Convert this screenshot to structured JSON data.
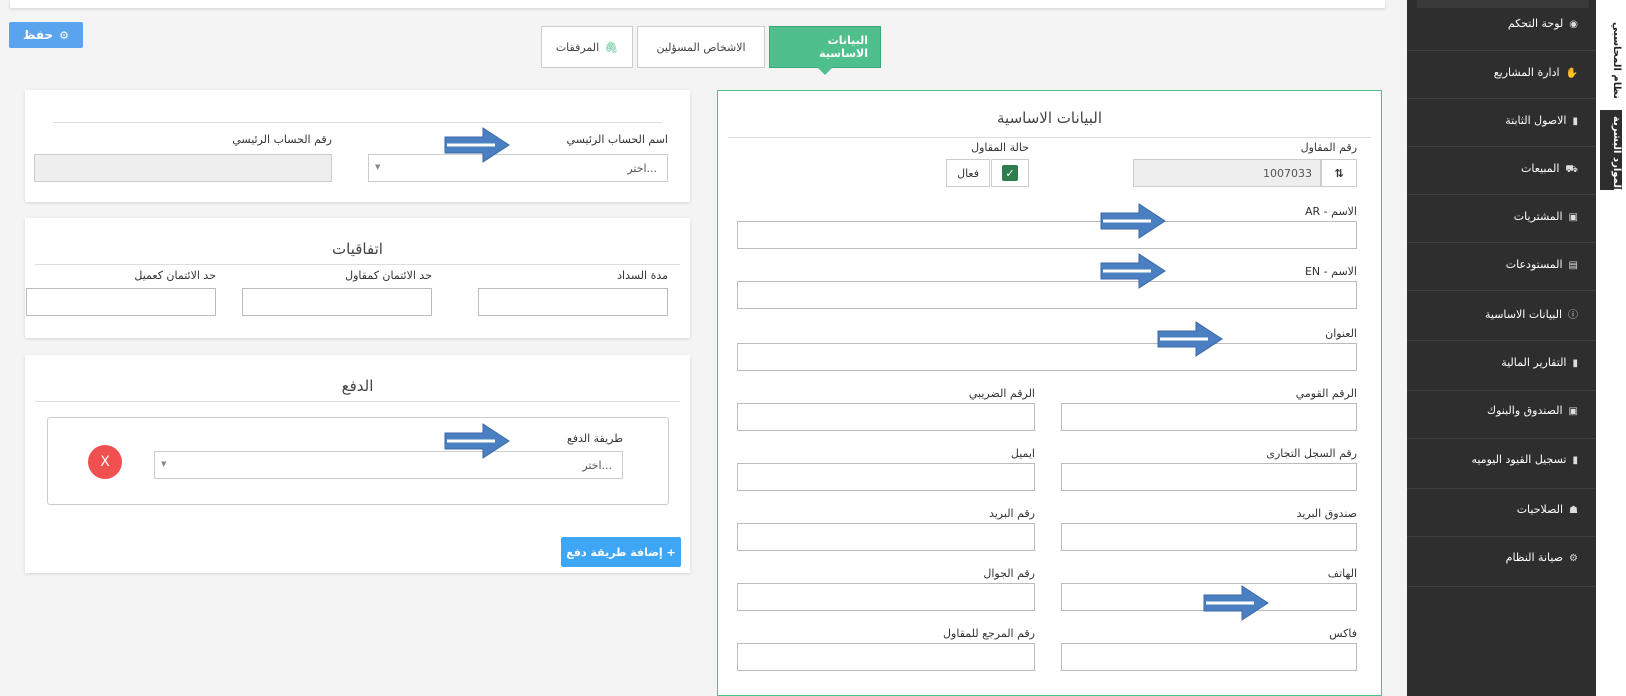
{
  "header": {
    "save_label": "حفظ"
  },
  "tabs": [
    {
      "label": "البيانات الاساسية",
      "active": true
    },
    {
      "label": "الاشخاص المسؤلين",
      "active": false
    },
    {
      "label": "المرفقات",
      "active": false
    }
  ],
  "basic": {
    "title": "البيانات الاساسية",
    "contractor_no_label": "رقم المقاول",
    "contractor_no_value": "1007033",
    "status_label": "حالة المقاول",
    "status_value": "فعال",
    "name_ar_label": "الاسم - AR",
    "name_en_label": "الاسم - EN",
    "address_label": "العنوان",
    "national_id_label": "الرقم القومي",
    "tax_no_label": "الرقم الضريبي",
    "commercial_reg_label": "رقم السجل التجارى",
    "email_label": "ايميل",
    "po_box_label": "صندوق البريد",
    "postal_code_label": "رقم البريد",
    "phone_label": "الهاتف",
    "mobile_label": "رقم الجوال",
    "fax_label": "فاكس",
    "reference_label": "رقم المرجع للمقاول"
  },
  "account": {
    "main_account_name_label": "اسم الحساب الرئيسي",
    "main_account_placeholder": "اختر...",
    "main_account_no_label": "رقم الحساب الرئيسي"
  },
  "agreements": {
    "title": "اتفاقيات",
    "payment_period_label": "مدة السداد",
    "credit_limit_contractor_label": "حد الائتمان كمقاول",
    "credit_limit_client_label": "حد الائتمان كعميل"
  },
  "payment": {
    "title": "الدفع",
    "method_label": "طريقة الدفع",
    "method_placeholder": "اختر...",
    "remove_label": "X",
    "add_label": "+ إضافة طريقة دفع"
  },
  "sidebar": {
    "items": [
      {
        "label": "لوحة التحكم",
        "icon": "dashboard-icon",
        "glyph": "◉"
      },
      {
        "label": "ادارة المشاريع",
        "icon": "handshake-icon",
        "glyph": "✋"
      },
      {
        "label": "الاصول الثابتة",
        "icon": "file-icon",
        "glyph": "▮"
      },
      {
        "label": "المبيعات",
        "icon": "truck-icon",
        "glyph": "⛟"
      },
      {
        "label": "المشتريات",
        "icon": "money-icon",
        "glyph": "▣"
      },
      {
        "label": "المستودعات",
        "icon": "archive-icon",
        "glyph": "▤"
      },
      {
        "label": "البيانات الاساسية",
        "icon": "info-icon",
        "glyph": "ⓘ"
      },
      {
        "label": "التقارير المالية",
        "icon": "file-icon",
        "glyph": "▮"
      },
      {
        "label": "الصندوق والبنوك",
        "icon": "money-icon",
        "glyph": "▣"
      },
      {
        "label": "تسجيل القيود اليوميه",
        "icon": "file-icon",
        "glyph": "▮"
      },
      {
        "label": "الصلاحيات",
        "icon": "users-icon",
        "glyph": "☗"
      },
      {
        "label": "صيانة النظام",
        "icon": "gear-icon",
        "glyph": "⚙"
      }
    ],
    "vtabs": [
      "نظام المحاسبي",
      "الموارد البشرية"
    ]
  }
}
